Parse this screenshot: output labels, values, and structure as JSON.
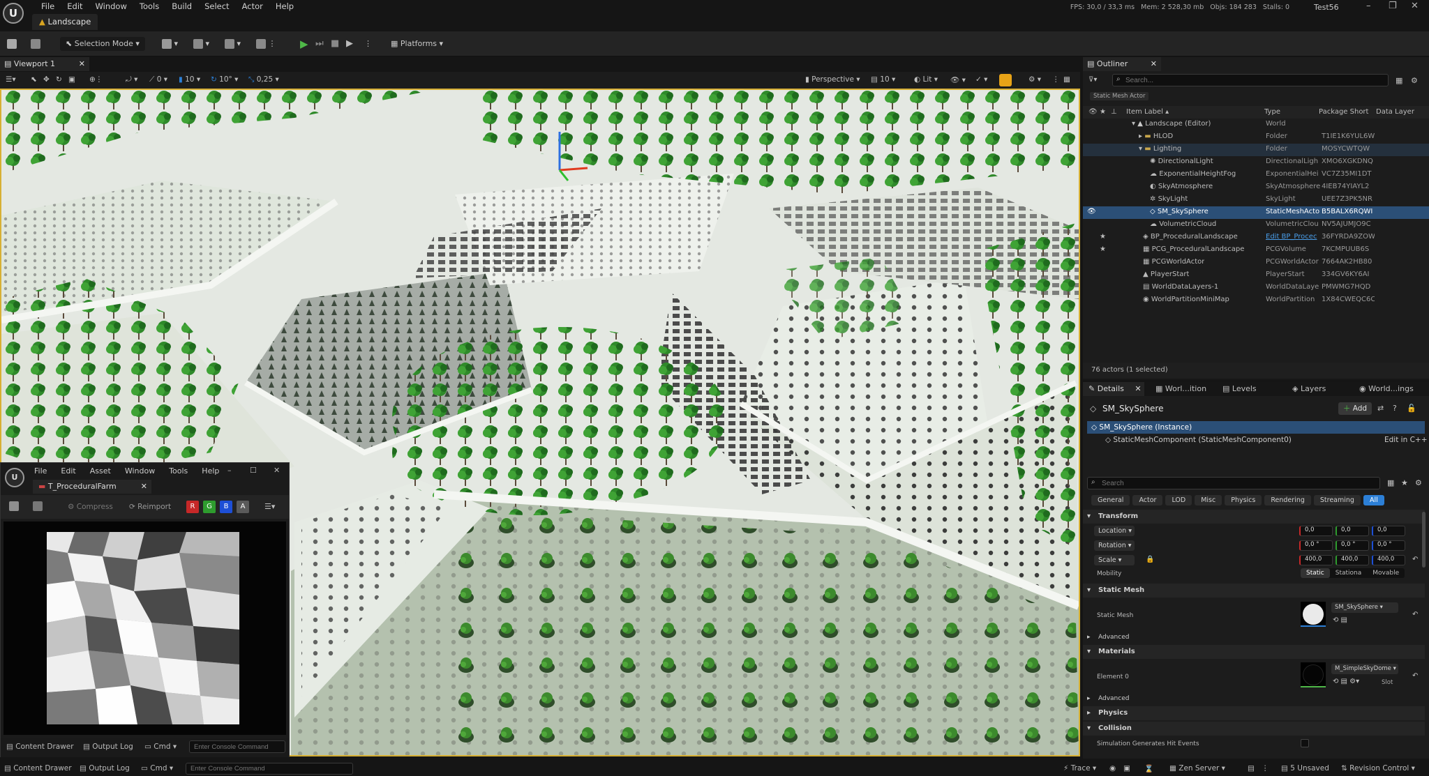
{
  "app": {
    "title": "Landscape",
    "project": "Test56"
  },
  "menu": [
    "File",
    "Edit",
    "Window",
    "Tools",
    "Build",
    "Select",
    "Actor",
    "Help"
  ],
  "stats": {
    "fps": "FPS: 30,0",
    "ms": "33,3 ms",
    "mem": "Mem: 2 528,30 mb",
    "objs": "Objs: 184 283",
    "stalls": "Stalls: 0"
  },
  "toolbar": {
    "selection_mode": "Selection Mode",
    "platforms": "Platforms"
  },
  "viewport": {
    "tab": "Viewport 1",
    "grid_angle": "0",
    "grid_snap": "10",
    "rot_snap": "10°",
    "scale_snap": "0,25",
    "perspective": "Perspective",
    "lit": "Lit",
    "cam_speed": "10"
  },
  "texture_editor": {
    "menu": [
      "File",
      "Edit",
      "Asset",
      "Window",
      "Tools",
      "Help"
    ],
    "tab": "T_ProceduralFarm",
    "compress": "Compress",
    "reimport": "Reimport",
    "channels": [
      "R",
      "G",
      "B",
      "A"
    ],
    "content_drawer": "Content Drawer",
    "output_log": "Output Log",
    "cmd": "Cmd",
    "console_placeholder": "Enter Console Command"
  },
  "outliner": {
    "title": "Outliner",
    "search_placeholder": "Search...",
    "filter_chip": "Static Mesh Actor",
    "columns": [
      "Item Label",
      "Type",
      "Package Short",
      "Data Layer"
    ],
    "rows": [
      {
        "label": "Landscape (Editor)",
        "type": "World",
        "pkg": ""
      },
      {
        "label": "HLOD",
        "type": "Folder",
        "pkg": "T1IE1K6YUL6W"
      },
      {
        "label": "Lighting",
        "type": "Folder",
        "pkg": "MOSYCWTQW"
      },
      {
        "label": "DirectionalLight",
        "type": "DirectionalLigh",
        "pkg": "XMO6XGKDNQ"
      },
      {
        "label": "ExponentialHeightFog",
        "type": "ExponentialHei",
        "pkg": "VC7Z35MI1DT"
      },
      {
        "label": "SkyAtmosphere",
        "type": "SkyAtmosphere",
        "pkg": "4IEB74YIAYL2"
      },
      {
        "label": "SkyLight",
        "type": "SkyLight",
        "pkg": "UEE7Z3PK5NR"
      },
      {
        "label": "SM_SkySphere",
        "type": "StaticMeshActo",
        "pkg": "B5BALX6RQWI"
      },
      {
        "label": "VolumetricCloud",
        "type": "VolumetricClou",
        "pkg": "NV5AJUMJO9C"
      },
      {
        "label": "BP_ProceduralLandscape",
        "type": "Edit BP_Procec",
        "pkg": "36FYRDA9ZOW"
      },
      {
        "label": "PCG_ProceduralLandscape",
        "type": "PCGVolume",
        "pkg": "7KCMPUUB6S"
      },
      {
        "label": "PCGWorldActor",
        "type": "PCGWorldActor",
        "pkg": "7664AK2HB80"
      },
      {
        "label": "PlayerStart",
        "type": "PlayerStart",
        "pkg": "334GV6KY6AI"
      },
      {
        "label": "WorldDataLayers-1",
        "type": "WorldDataLaye",
        "pkg": "PMWMG7HQD"
      },
      {
        "label": "WorldPartitionMiniMap",
        "type": "WorldPartition",
        "pkg": "1X84CWEQC6C"
      }
    ],
    "footer": "76 actors (1 selected)"
  },
  "details": {
    "tabs": [
      "Details",
      "Worl...ition",
      "Levels",
      "Layers",
      "World...ings"
    ],
    "actor_name": "SM_SkySphere",
    "add": "Add",
    "instance": "SM_SkySphere (Instance)",
    "component": "StaticMeshComponent (StaticMeshComponent0)",
    "edit_cpp": "Edit in C++",
    "search_placeholder": "Search",
    "filters": [
      "General",
      "Actor",
      "LOD",
      "Misc",
      "Physics",
      "Rendering",
      "Streaming",
      "All"
    ],
    "transform": {
      "header": "Transform",
      "location_label": "Location",
      "location": [
        "0,0",
        "0,0",
        "0,0"
      ],
      "rotation_label": "Rotation",
      "rotation": [
        "0,0 °",
        "0,0 °",
        "0,0 °"
      ],
      "scale_label": "Scale",
      "scale": [
        "400,0",
        "400,0",
        "400,0"
      ],
      "mobility_label": "Mobility",
      "mobility": [
        "Static",
        "Stationa",
        "Movable"
      ]
    },
    "static_mesh": {
      "header": "Static Mesh",
      "label": "Static Mesh",
      "value": "SM_SkySphere",
      "advanced": "Advanced"
    },
    "materials": {
      "header": "Materials",
      "label": "Element 0",
      "value": "M_SimpleSkyDome",
      "slot": "Slot",
      "advanced": "Advanced"
    },
    "physics": "Physics",
    "collision": "Collision",
    "sim_hit": "Simulation Generates Hit Events"
  },
  "statusbar": {
    "content_drawer": "Content Drawer",
    "output_log": "Output Log",
    "cmd": "Cmd",
    "console_placeholder": "Enter Console Command",
    "trace": "Trace",
    "zen": "Zen Server",
    "unsaved": "5 Unsaved",
    "revision": "Revision Control"
  },
  "colors": {
    "accent": "#2c7fd6",
    "selection": "#2b4f77",
    "viewport_border": "#d7b034",
    "play": "#4fb848"
  }
}
